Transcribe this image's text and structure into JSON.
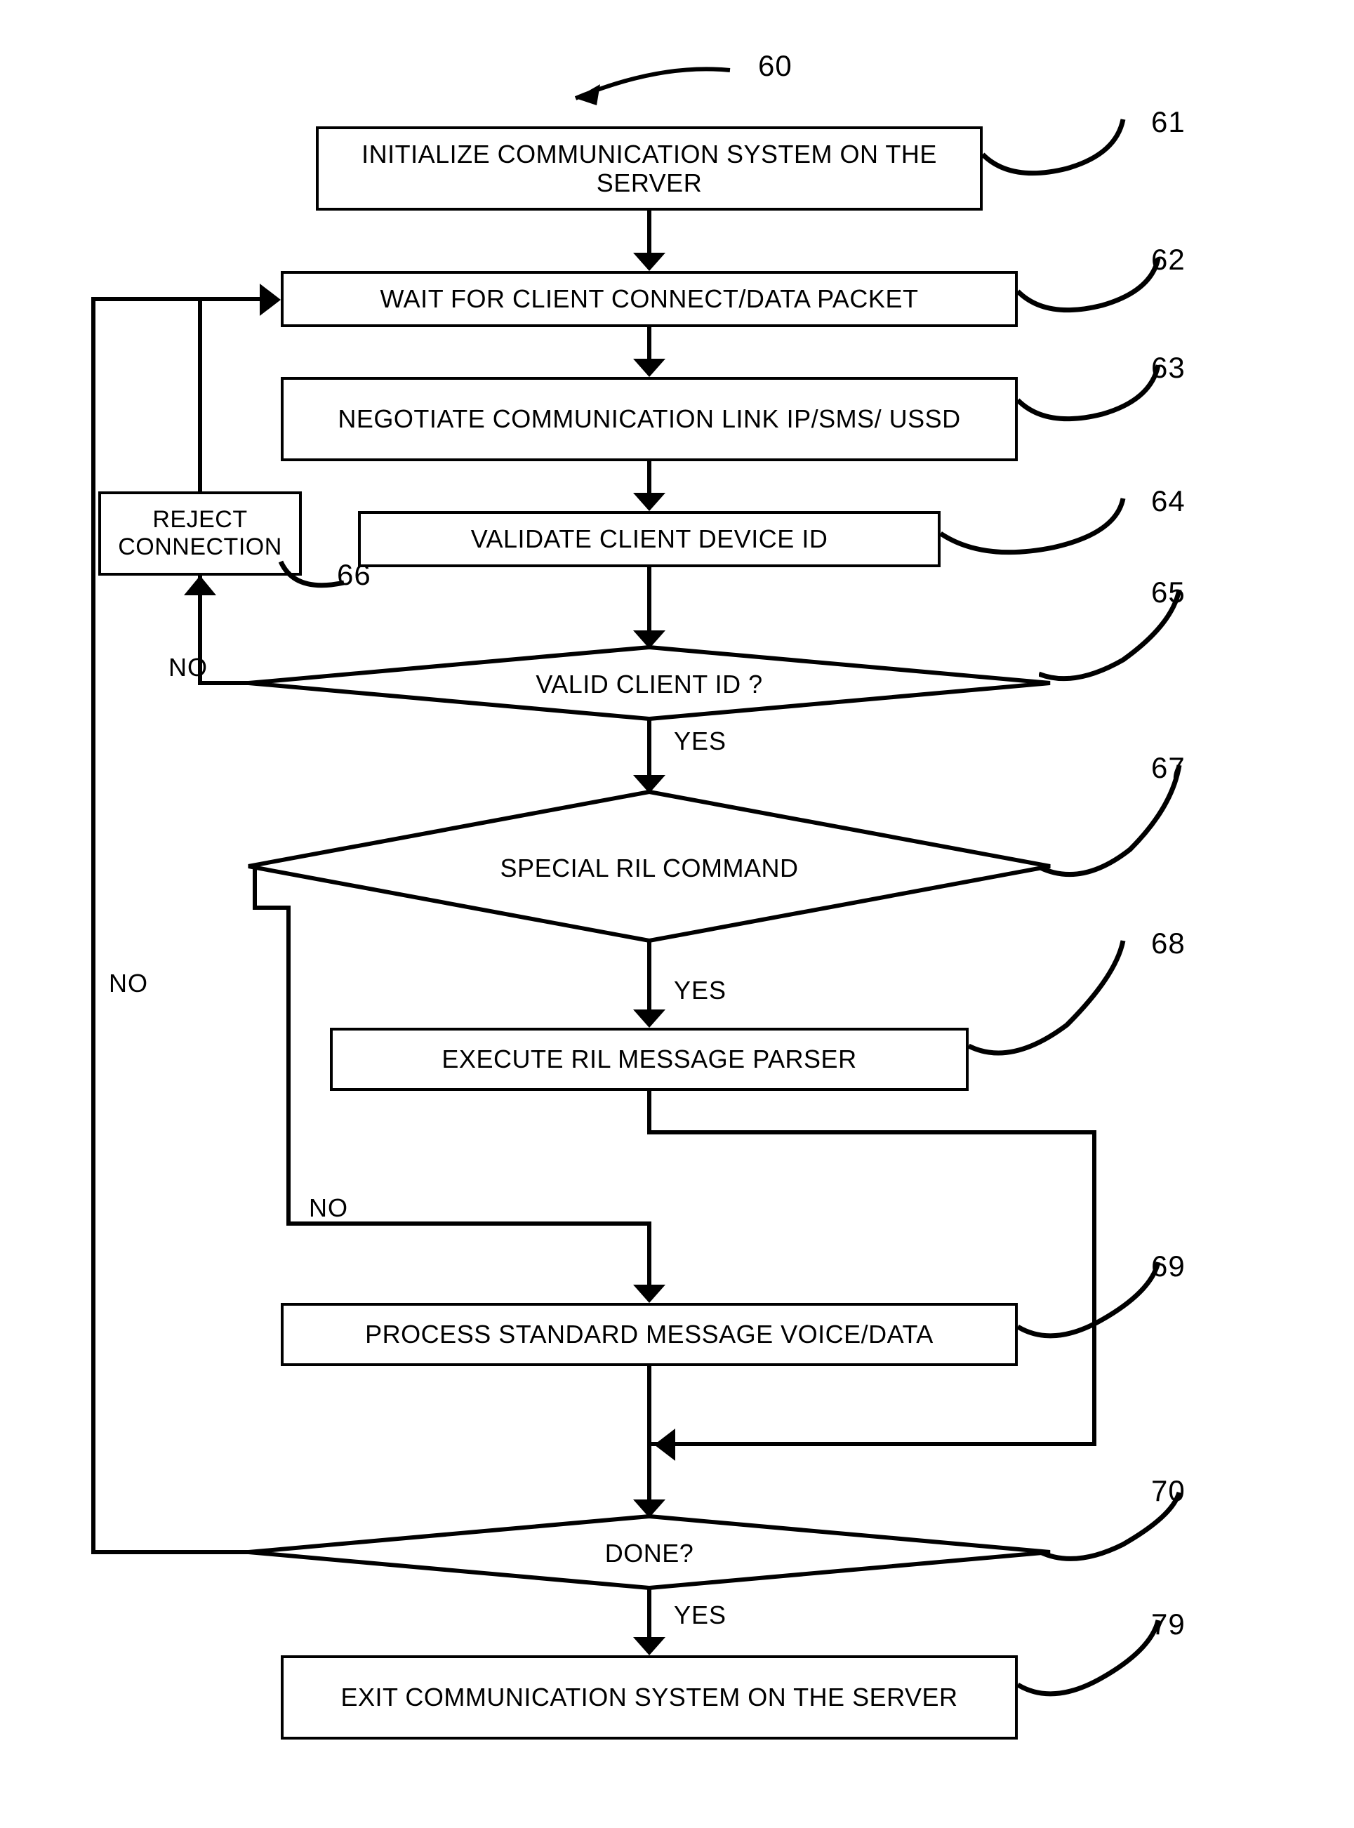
{
  "figureRef": "60",
  "nodes": {
    "n61": {
      "ref": "61",
      "text": "INITIALIZE COMMUNICATION SYSTEM ON THE SERVER"
    },
    "n62": {
      "ref": "62",
      "text": "WAIT FOR CLIENT CONNECT/DATA PACKET"
    },
    "n63": {
      "ref": "63",
      "text": "NEGOTIATE COMMUNICATION LINK IP/SMS/ USSD"
    },
    "n64": {
      "ref": "64",
      "text": "VALIDATE CLIENT DEVICE ID"
    },
    "n65": {
      "ref": "65",
      "text": "VALID CLIENT ID ?"
    },
    "n66": {
      "ref": "66",
      "text": "REJECT CONNECTION"
    },
    "n67": {
      "ref": "67",
      "text": "SPECIAL RIL COMMAND"
    },
    "n68": {
      "ref": "68",
      "text": "EXECUTE RIL MESSAGE PARSER"
    },
    "n69": {
      "ref": "69",
      "text": "PROCESS STANDARD MESSAGE VOICE/DATA"
    },
    "n70": {
      "ref": "70",
      "text": "DONE?"
    },
    "n79": {
      "ref": "79",
      "text": "EXIT COMMUNICATION SYSTEM ON THE SERVER"
    }
  },
  "labels": {
    "yes": "YES",
    "no": "NO"
  }
}
